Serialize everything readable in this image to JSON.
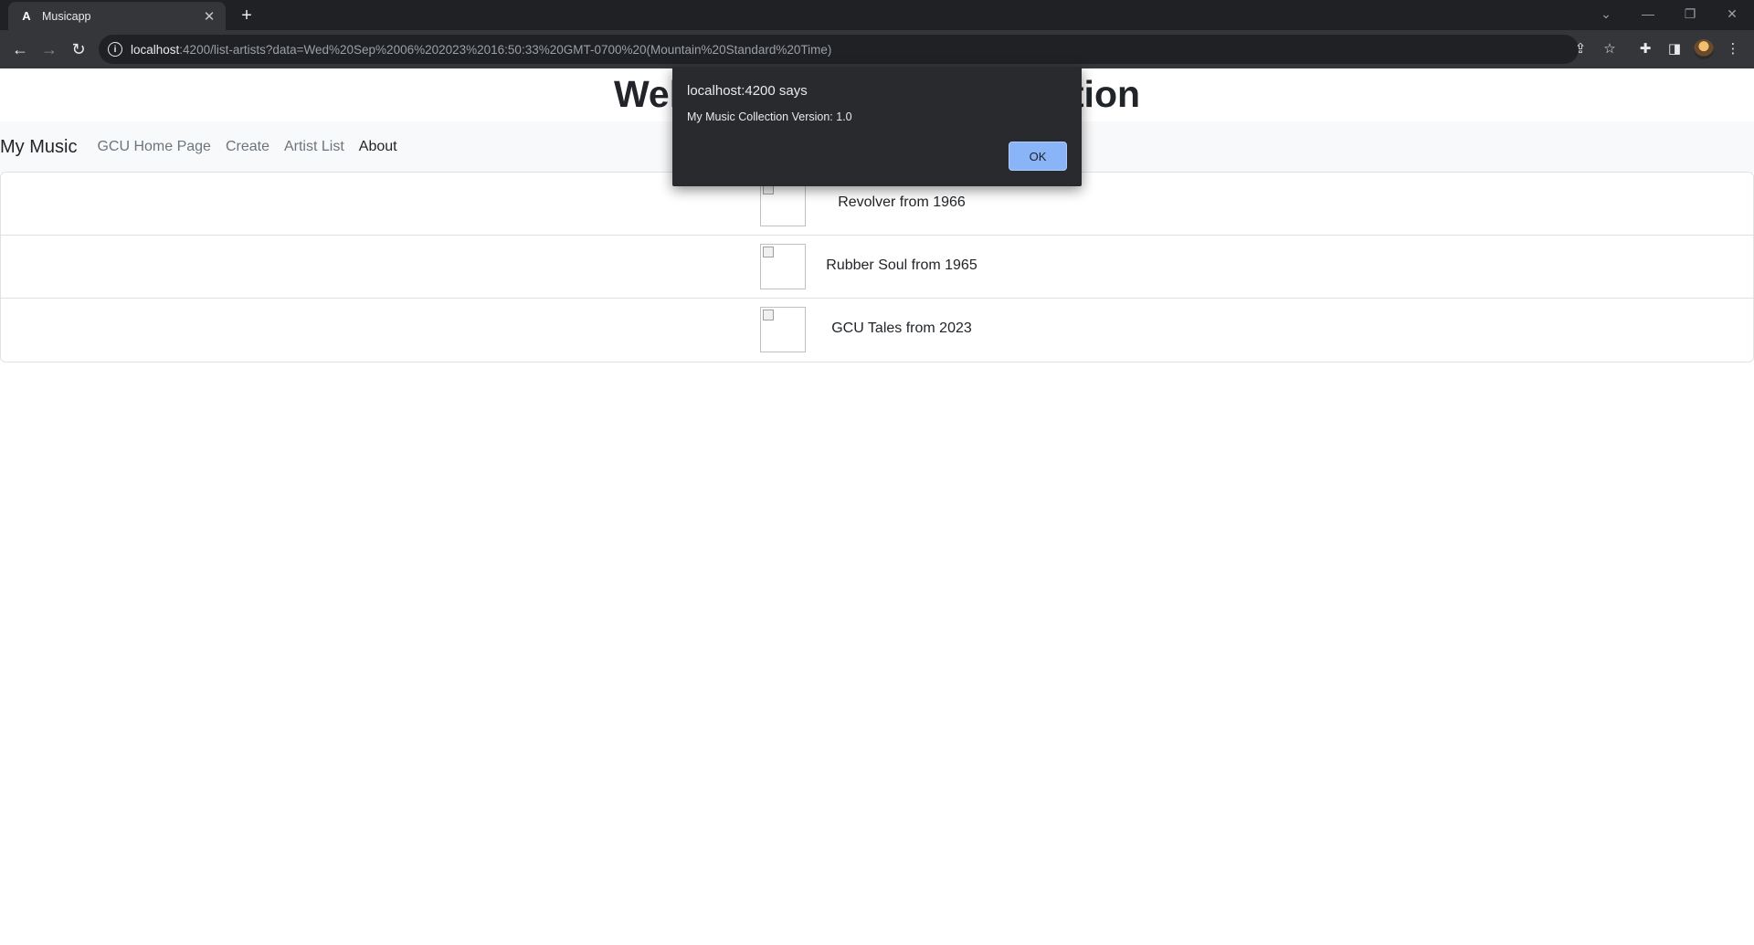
{
  "browser": {
    "tab_title": "Musicapp",
    "tab_favicon": "A",
    "url_host": "localhost",
    "url_rest": ":4200/list-artists?data=Wed%20Sep%2006%202023%2016:50:33%20GMT-0700%20(Mountain%20Standard%20Time)"
  },
  "page": {
    "heading_left": "Welc",
    "heading_right": "tion",
    "navbar": {
      "brand": "My Music",
      "links": [
        "GCU Home Page",
        "Create",
        "Artist List",
        "About"
      ]
    },
    "albums": [
      {
        "title": "Revolver from 1966"
      },
      {
        "title": "Rubber Soul from 1965"
      },
      {
        "title": "GCU Tales from 2023"
      }
    ]
  },
  "dialog": {
    "title": "localhost:4200 says",
    "message": "My Music Collection Version: 1.0",
    "ok_label": "OK"
  },
  "icons": [
    "back-arrow-icon",
    "forward-arrow-icon",
    "reload-icon",
    "info-icon",
    "share-icon",
    "star-icon",
    "extensions-icon",
    "side-panel-icon",
    "menu-icon",
    "close-icon",
    "plus-icon",
    "minimize-icon",
    "restore-icon",
    "chevron-down-icon"
  ]
}
